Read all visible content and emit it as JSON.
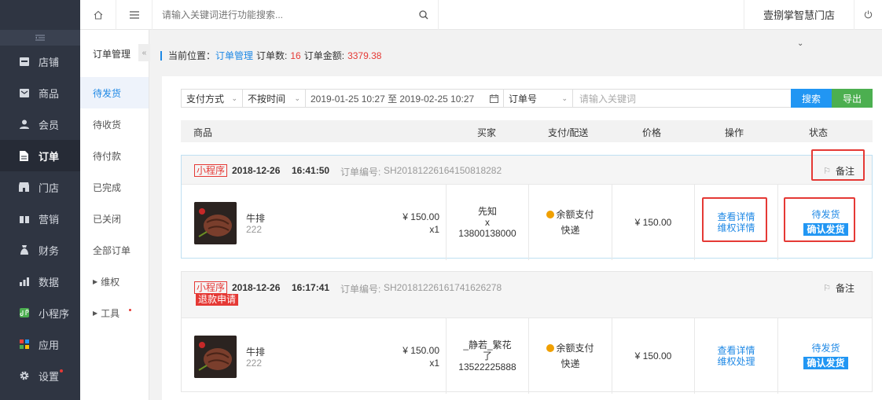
{
  "header": {
    "search_placeholder": "请输入关键词进行功能搜索...",
    "store_name": "壹捌掌智慧门店"
  },
  "nav": {
    "items": [
      {
        "label": "店铺",
        "icon": "store-icon"
      },
      {
        "label": "商品",
        "icon": "goods-icon"
      },
      {
        "label": "会员",
        "icon": "member-icon"
      },
      {
        "label": "订单",
        "icon": "order-icon"
      },
      {
        "label": "门店",
        "icon": "shop-icon"
      },
      {
        "label": "营销",
        "icon": "gift-icon"
      },
      {
        "label": "财务",
        "icon": "finance-icon"
      },
      {
        "label": "数据",
        "icon": "chart-icon"
      },
      {
        "label": "小程序",
        "icon": "miniapp-icon"
      },
      {
        "label": "应用",
        "icon": "apps-icon"
      },
      {
        "label": "设置",
        "icon": "gear-icon"
      }
    ]
  },
  "sub": {
    "title": "订单管理",
    "items": [
      "待发货",
      "待收货",
      "待付款",
      "已完成",
      "已关闭",
      "全部订单",
      "维权",
      "工具"
    ]
  },
  "breadcrumb": {
    "prefix": "当前位置：",
    "current": "订单管理",
    "count_label": "订单数:",
    "count": "16",
    "amount_label": "订单金额:",
    "amount": "3379.38"
  },
  "filter": {
    "pay_method": "支付方式",
    "time_option": "不按时间",
    "date_range": "2019-01-25 10:27 至 2019-02-25 10:27",
    "field": "订单号",
    "keyword_placeholder": "请输入关键词",
    "search_label": "搜索",
    "export_label": "导出"
  },
  "table": {
    "headers": [
      "商品",
      "买家",
      "支付/配送",
      "价格",
      "操作",
      "状态"
    ]
  },
  "orders": [
    {
      "source": "小程序",
      "refund_tag": "",
      "date": "2018-12-26",
      "time": "16:41:50",
      "no_label": "订单编号:",
      "no": "SH20181226164150818282",
      "remark": "备注",
      "product_name": "牛排",
      "product_sku": "222",
      "unit_price": "¥ 150.00",
      "qty": "x1",
      "buyer_name": "先知",
      "buyer_x": "x",
      "buyer_phone": "13800138000",
      "pay": "余额支付",
      "delivery": "快递",
      "price": "¥ 150.00",
      "op1": "查看详情",
      "op2": "维权详情",
      "status": "待发货",
      "action": "确认发货"
    },
    {
      "source": "小程序",
      "refund_tag": "退款申请",
      "date": "2018-12-26",
      "time": "16:17:41",
      "no_label": "订单编号:",
      "no": "SH20181226161741626278",
      "remark": "备注",
      "product_name": "牛排",
      "product_sku": "222",
      "unit_price": "¥ 150.00",
      "qty": "x1",
      "buyer_name": "_静若_繁花",
      "buyer_x": "了",
      "buyer_phone": "13522225888",
      "pay": "余额支付",
      "delivery": "快递",
      "price": "¥ 150.00",
      "op1": "查看详情",
      "op2": "维权处理",
      "status": "待发货",
      "action": "确认发货"
    }
  ]
}
